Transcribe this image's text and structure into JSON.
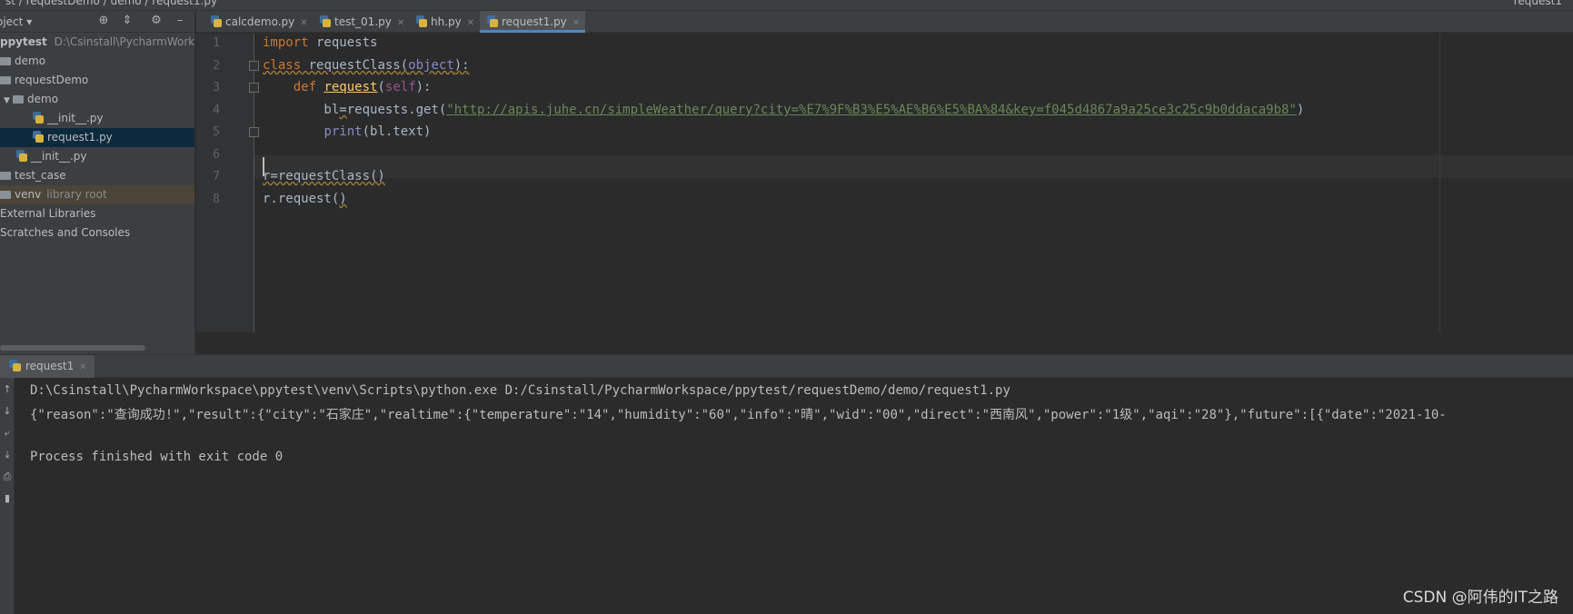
{
  "breadcrumb": {
    "text": "st  /  requestDemo  /  demo  /  request1.py",
    "run_config": "request1"
  },
  "project_panel": {
    "title": "oject",
    "root_name": "ppytest",
    "root_path": "D:\\Csinstall\\PycharmWorkspa",
    "items": [
      {
        "label": "demo",
        "kind": "folder"
      },
      {
        "label": "requestDemo",
        "kind": "folder"
      },
      {
        "label": "demo",
        "kind": "folder"
      },
      {
        "label": "__init__.py",
        "kind": "python-file"
      },
      {
        "label": "request1.py",
        "kind": "python-file"
      },
      {
        "label": "__init__.py",
        "kind": "python-file"
      },
      {
        "label": "test_case",
        "kind": "folder"
      },
      {
        "label": "venv",
        "kind": "folder",
        "note": "library root"
      },
      {
        "label": "External Libraries",
        "kind": "library"
      },
      {
        "label": "Scratches and Consoles",
        "kind": "scratch"
      }
    ]
  },
  "editor_tabs": [
    {
      "label": "calcdemo.py"
    },
    {
      "label": "test_01.py"
    },
    {
      "label": "hh.py"
    },
    {
      "label": "request1.py",
      "active": true
    }
  ],
  "code": {
    "line_numbers": [
      "1",
      "2",
      "3",
      "4",
      "5",
      "6",
      "7",
      "8"
    ],
    "lines": {
      "l1_kw": "import",
      "l1_rest": " requests",
      "l2_kw": "class",
      "l2_name": " requestClass",
      "l2_paren_open": "(",
      "l2_base": "object",
      "l2_paren_close": "):",
      "l3_indent": "    ",
      "l3_kw": "def",
      "l3_name": "request",
      "l3_paren_open": "(",
      "l3_self": "self",
      "l3_paren_close": "):",
      "l4_pre": "        bl",
      "l4_eq": "=",
      "l4_mid": "requests.get(",
      "l4_str": "\"http://apis.juhe.cn/simpleWeather/query?city=%E7%9F%B3%E5%AE%B6%E5%BA%84&key=f045d4867a9a25ce3c25c9b0ddaca9b8\"",
      "l4_end": ")",
      "l5_indent": "        ",
      "l5_print": "print",
      "l5_rest": "(bl.text)",
      "l7": "r=requestClass()",
      "l8_pre": "r.request(",
      "l8_end": ")"
    }
  },
  "run_panel": {
    "tab_label": "request1",
    "console_lines": [
      "D:\\Csinstall\\PycharmWorkspace\\ppytest\\venv\\Scripts\\python.exe D:/Csinstall/PycharmWorkspace/ppytest/requestDemo/demo/request1.py",
      "{\"reason\":\"查询成功!\",\"result\":{\"city\":\"石家庄\",\"realtime\":{\"temperature\":\"14\",\"humidity\":\"60\",\"info\":\"晴\",\"wid\":\"00\",\"direct\":\"西南风\",\"power\":\"1级\",\"aqi\":\"28\"},\"future\":[{\"date\":\"2021-10-",
      "",
      "Process finished with exit code 0"
    ]
  },
  "watermark": "CSDN @阿伟的IT之路"
}
